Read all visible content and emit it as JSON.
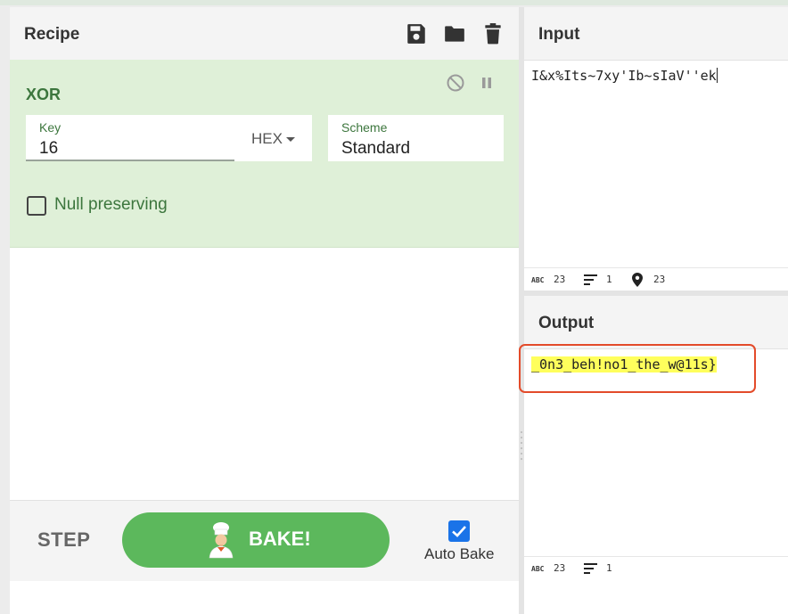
{
  "recipe": {
    "title": "Recipe",
    "icons": {
      "save": "save-icon",
      "open": "folder-icon",
      "clear": "trash-icon"
    }
  },
  "operation": {
    "name": "XOR",
    "key": {
      "label": "Key",
      "value": "16"
    },
    "key_format": "HEX",
    "scheme": {
      "label": "Scheme",
      "value": "Standard"
    },
    "null_preserving": {
      "label": "Null preserving",
      "checked": false
    }
  },
  "controls": {
    "step_label": "STEP",
    "bake_label": "BAKE!",
    "auto_bake": {
      "label": "Auto Bake",
      "checked": true
    }
  },
  "input": {
    "title": "Input",
    "text": "I&x%Its~7xy'Ib~sIaV''ek",
    "status": {
      "abc_icon": "ABC",
      "length": "23",
      "lines": "1",
      "position": "23"
    }
  },
  "output": {
    "title": "Output",
    "text": "_0n3_beh!no1_the_w@11s}",
    "status": {
      "abc_icon": "ABC",
      "length": "23",
      "lines": "1"
    }
  },
  "colors": {
    "operation_bg": "#dff0d8",
    "operation_text": "#3c763d",
    "bake_button": "#5cb85c",
    "checkbox_checked": "#1a73e8",
    "output_highlight": "#ffff5c",
    "annotation_box": "#e34b2a"
  }
}
